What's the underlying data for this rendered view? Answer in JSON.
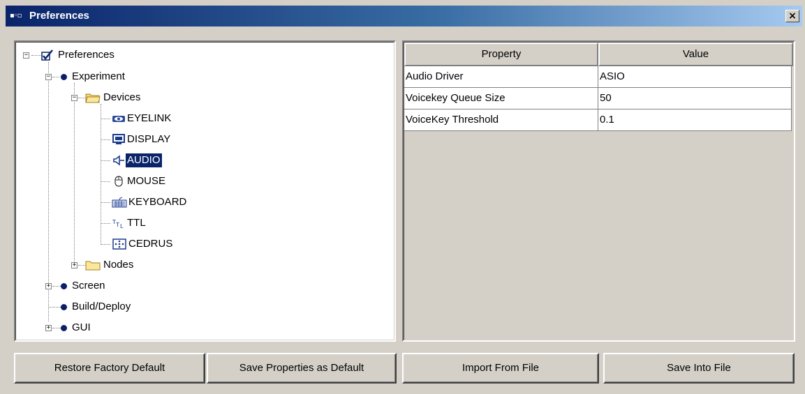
{
  "window": {
    "title": "Preferences",
    "close_label": "×"
  },
  "tree": {
    "root": "Preferences",
    "experiment": "Experiment",
    "devices": "Devices",
    "devices_items": [
      "EYELINK",
      "DISPLAY",
      "AUDIO",
      "MOUSE",
      "KEYBOARD",
      "TTL",
      "CEDRUS"
    ],
    "selected": "AUDIO",
    "nodes": "Nodes",
    "screen": "Screen",
    "build_deploy": "Build/Deploy",
    "gui": "GUI"
  },
  "table": {
    "headers": [
      "Property",
      "Value"
    ],
    "rows": [
      [
        "Audio Driver",
        "ASIO"
      ],
      [
        "Voicekey Queue Size",
        "50"
      ],
      [
        "VoiceKey Threshold",
        "0.1"
      ]
    ]
  },
  "buttons": {
    "restore_default": "Restore Factory Default",
    "save_as_default": "Save Properties as Default",
    "import_file": "Import From File",
    "save_file": "Save Into File"
  },
  "colors": {
    "selection": "#0a246a",
    "title_gradient_start": "#0a246a",
    "title_gradient_end": "#a6caf0",
    "face": "#d4d0c8"
  }
}
